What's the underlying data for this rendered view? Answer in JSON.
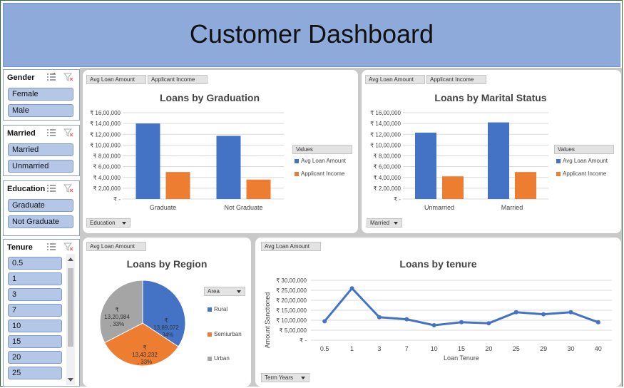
{
  "title": "Customer Dashboard",
  "slicers": [
    {
      "name": "gender",
      "header": "Gender",
      "items": [
        "Female",
        "Male"
      ]
    },
    {
      "name": "married",
      "header": "Married",
      "items": [
        "Married",
        "Unmarried"
      ]
    },
    {
      "name": "education",
      "header": "Education",
      "items": [
        "Graduate",
        "Not Graduate"
      ]
    },
    {
      "name": "tenure",
      "header": "Tenure",
      "items": [
        "0.5",
        "1",
        "3",
        "7",
        "10",
        "15",
        "20",
        "25"
      ]
    }
  ],
  "colors": {
    "blue": "#4472c4",
    "orange": "#ed7d31",
    "gray": "#a5a5a5",
    "title_band": "#8eaadb",
    "slicer_button": "#b4c7e7"
  },
  "charts": {
    "graduation": {
      "tags": [
        "Avg Loan Amount",
        "Applicant Income"
      ],
      "filter_label": "Education",
      "legend_title": "Values",
      "chart_data": {
        "type": "bar",
        "title": "Loans by Graduation",
        "categories": [
          "Graduate",
          "Not Graduate"
        ],
        "series": [
          {
            "name": "Avg Loan Amount",
            "values": [
              1400000,
              1170000
            ]
          },
          {
            "name": "Applicant Income",
            "values": [
              500000,
              360000
            ]
          }
        ],
        "ylim": [
          0,
          1600000
        ],
        "ytick_labels": [
          "₹ -",
          "₹ 2,00,000",
          "₹ 4,00,000",
          "₹ 6,00,000",
          "₹ 8,00,000",
          "₹ 10,00,000",
          "₹ 12,00,000",
          "₹ 14,00,000",
          "₹ 16,00,000"
        ]
      }
    },
    "marital": {
      "tags": [
        "Avg Loan Amount",
        "Applicant Income"
      ],
      "filter_label": "Married",
      "legend_title": "Values",
      "chart_data": {
        "type": "bar",
        "title": "Loans by Marital Status",
        "categories": [
          "Unmarried",
          "Married"
        ],
        "series": [
          {
            "name": "Avg Loan Amount",
            "values": [
              1230000,
              1420000
            ]
          },
          {
            "name": "Applicant Income",
            "values": [
              420000,
              500000
            ]
          }
        ],
        "ylim": [
          0,
          1600000
        ],
        "ytick_labels": [
          "₹ -",
          "₹ 2,00,000",
          "₹ 4,00,000",
          "₹ 6,00,000",
          "₹ 8,00,000",
          "₹ 10,00,000",
          "₹ 12,00,000",
          "₹ 14,00,000",
          "₹ 16,00,000"
        ]
      }
    },
    "region": {
      "tags": [
        "Avg Loan Amount"
      ],
      "legend_title": "Area",
      "chart_data": {
        "type": "pie",
        "title": "Loans by Region",
        "categories": [
          "Rural",
          "Semiurban",
          "Urban"
        ],
        "values": [
          1389072,
          1343232,
          1320984
        ],
        "labels": [
          [
            "₹",
            "13,89,072",
            ", 34%"
          ],
          [
            "₹",
            "13,43,232",
            ", 33%"
          ],
          [
            "₹",
            "13,20,984",
            ", 33%"
          ]
        ]
      }
    },
    "tenure": {
      "tags": [
        "Avg Loan Amount"
      ],
      "filter_label": "Term Years",
      "chart_data": {
        "type": "line",
        "title": "Loans by tenure",
        "xlabel": "Loan Tenure",
        "ylabel": "Amount Sanctioned",
        "categories": [
          "0.5",
          "1",
          "3",
          "7",
          "10",
          "15",
          "20",
          "25",
          "29",
          "30",
          "40"
        ],
        "series": [
          {
            "name": "Avg Loan Amount",
            "values": [
              950000,
              2600000,
              1150000,
              1050000,
              750000,
              900000,
              850000,
              1400000,
              1300000,
              1400000,
              900000
            ]
          }
        ],
        "ylim": [
          0,
          3000000
        ],
        "ytick_labels": [
          "₹ -",
          "₹ 5,00,000",
          "₹ 10,00,000",
          "₹ 15,00,000",
          "₹ 20,00,000",
          "₹ 25,00,000",
          "₹ 30,00,000"
        ]
      }
    }
  }
}
